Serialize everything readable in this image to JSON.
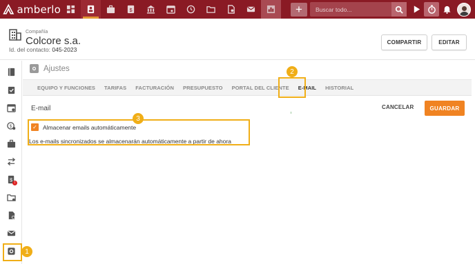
{
  "app": {
    "name": "amberlo"
  },
  "topnav": {
    "icons": [
      "dashboard-icon",
      "contacts-icon",
      "briefcase-icon",
      "invoice-icon",
      "bank-icon",
      "calendar-icon",
      "history-icon",
      "folder-icon",
      "document-icon",
      "mail-icon",
      "reports-icon"
    ],
    "add_label": "+",
    "search_placeholder": "Buscar todo..."
  },
  "header": {
    "kind_label": "Compañía",
    "title": "Colcore s.a.",
    "id_label": "Id. del contacto:",
    "id_value": "045-2023",
    "share_label": "COMPARTIR",
    "edit_label": "EDITAR"
  },
  "panel": {
    "title": "Ajustes",
    "tabs": [
      {
        "label": "EQUIPO Y FUNCIONES",
        "active": false
      },
      {
        "label": "TARIFAS",
        "active": false
      },
      {
        "label": "FACTURACIÓN",
        "active": false
      },
      {
        "label": "PRESUPUESTO",
        "active": false
      },
      {
        "label": "PORTAL DEL CLIENTE",
        "active": false
      },
      {
        "label": "E-MAIL",
        "active": true
      },
      {
        "label": "HISTORIAL",
        "active": false
      }
    ],
    "section_label": "E-mail",
    "cancel_label": "CANCELAR",
    "save_label": "GUARDAR",
    "checkbox_label": "Almacenar emails automáticamente",
    "checkbox_checked": true,
    "hint": "Los e-mails sincronizados se almacenarán automáticamente a partir de ahora"
  },
  "callouts": [
    "1",
    "2",
    "3"
  ],
  "colors": {
    "topbar": "#8a1a24",
    "accent": "#f08322",
    "callout": "#f0ae17"
  }
}
